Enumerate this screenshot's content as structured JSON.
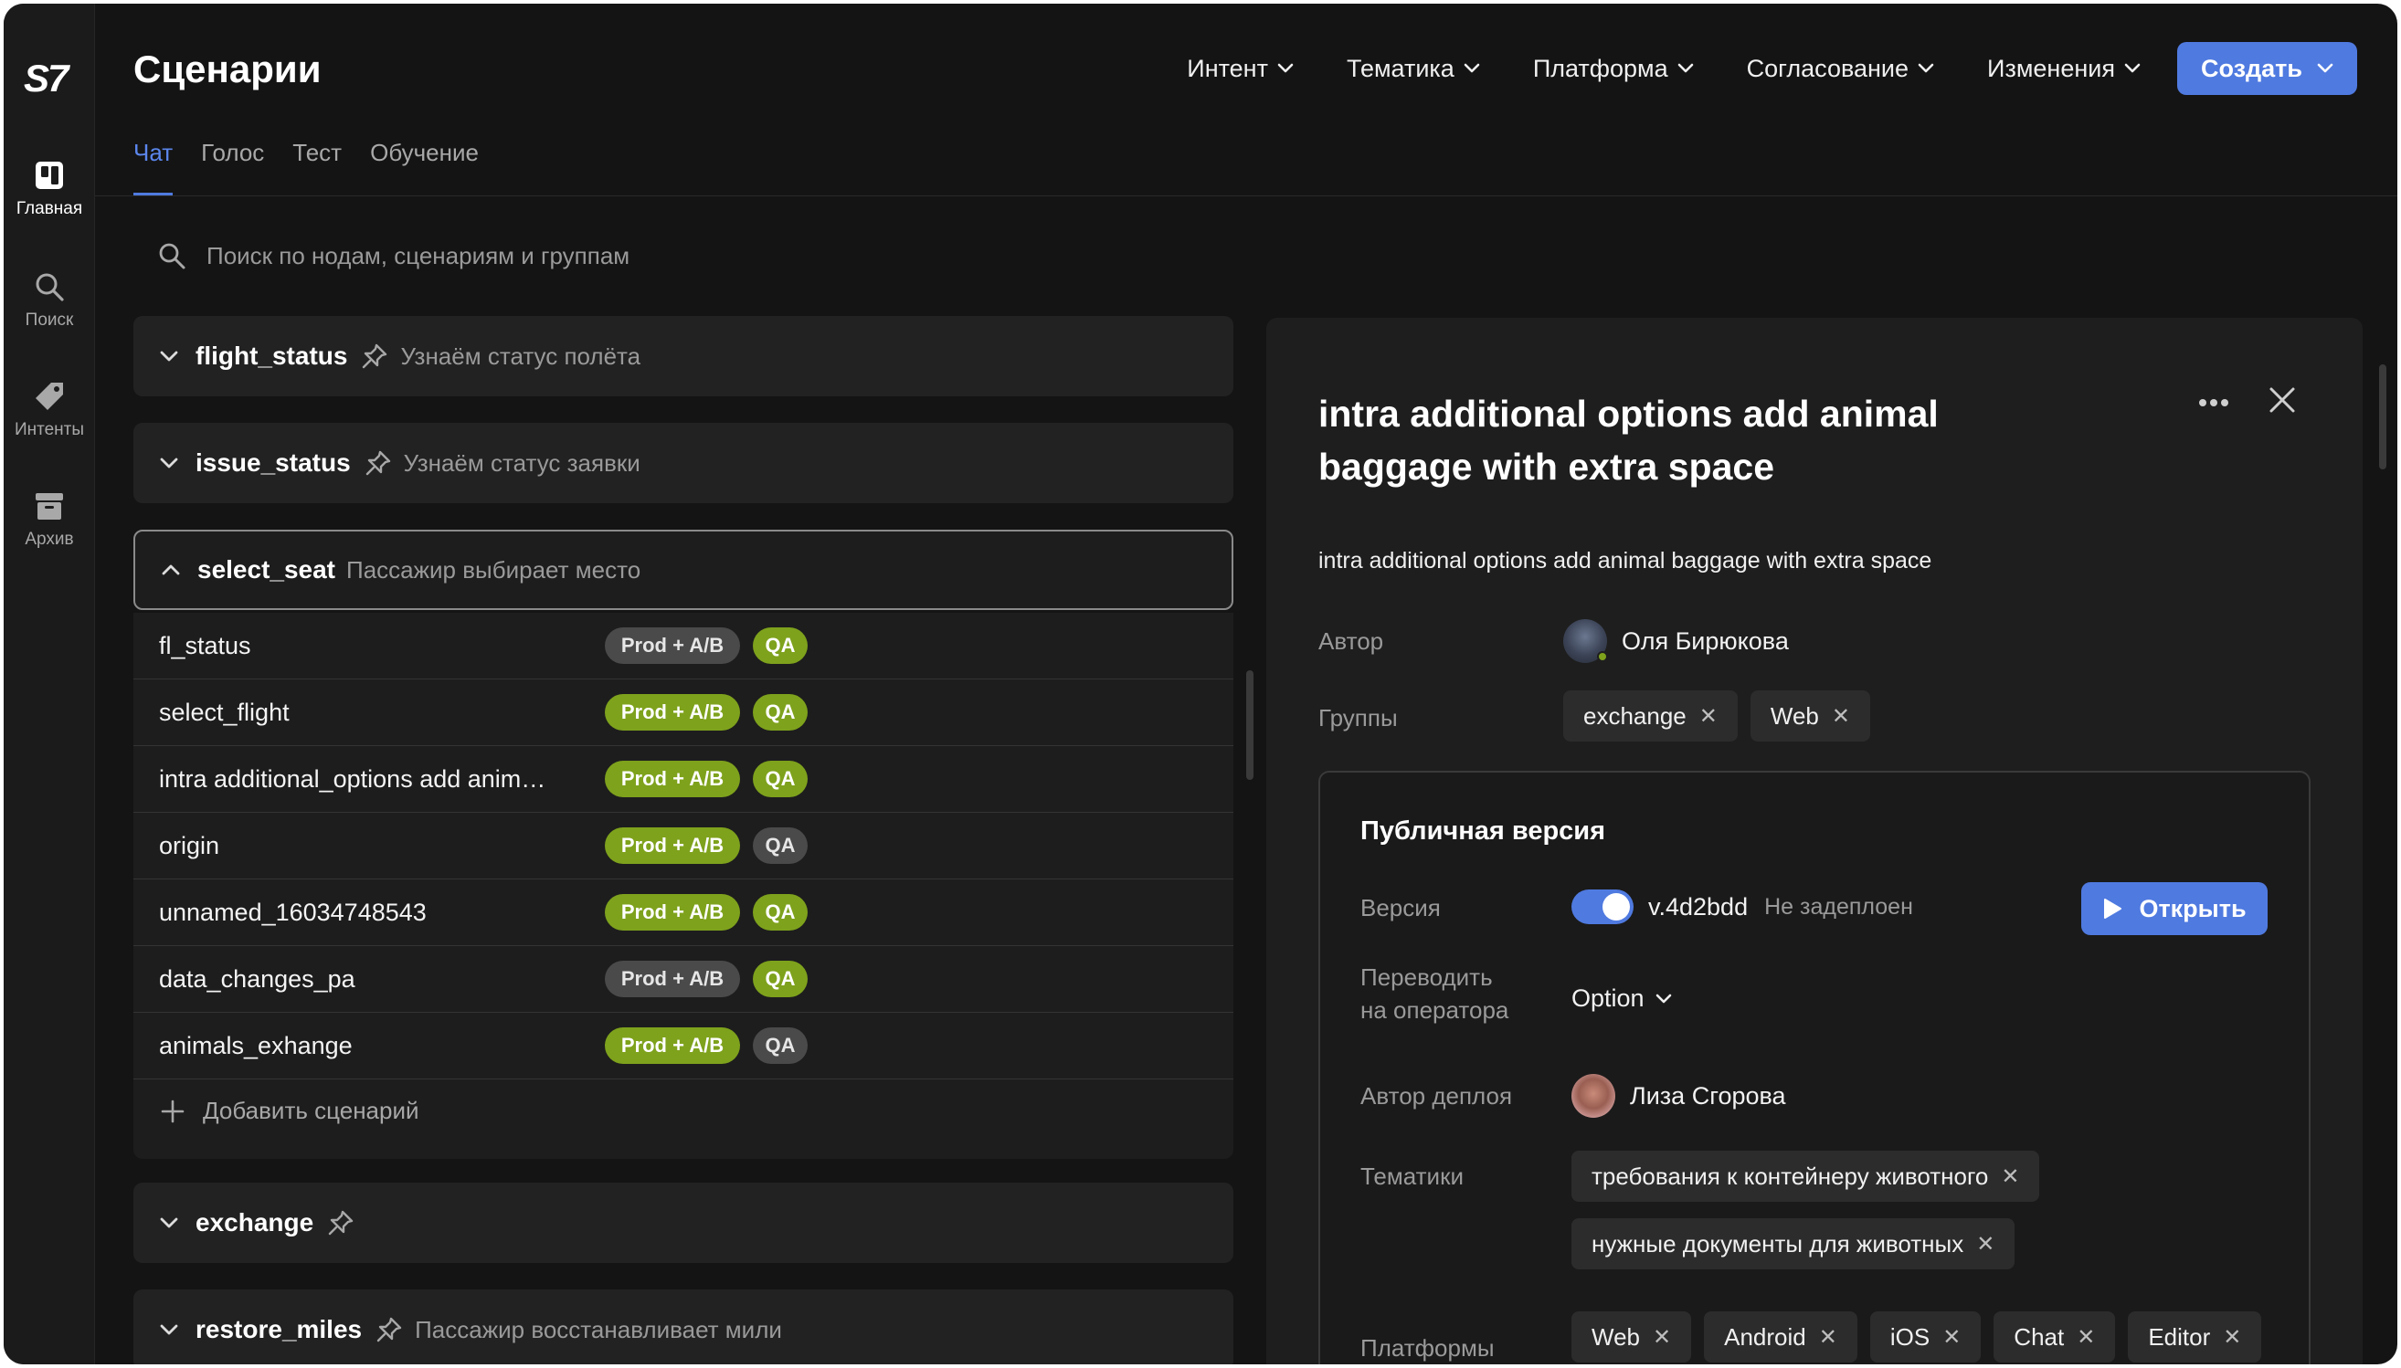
{
  "sidebar": {
    "logo": "S7",
    "items": [
      {
        "label": "Главная"
      },
      {
        "label": "Поиск"
      },
      {
        "label": "Интенты"
      },
      {
        "label": "Архив"
      }
    ]
  },
  "header": {
    "title": "Сценарии",
    "filters": [
      "Интент",
      "Тематика",
      "Платформа",
      "Согласование",
      "Изменения"
    ],
    "create_label": "Создать"
  },
  "tabs": [
    "Чат",
    "Голос",
    "Тест",
    "Обучение"
  ],
  "search": {
    "placeholder": "Поиск по нодам, сценариям и группам"
  },
  "groups": [
    {
      "name": "flight_status",
      "desc": "Узнаём статус полёта"
    },
    {
      "name": "issue_status",
      "desc": "Узнаём статус заявки"
    },
    {
      "name": "select_seat",
      "desc": "Пассажир выбирает место"
    },
    {
      "name": "exchange",
      "desc": ""
    },
    {
      "name": "restore_miles",
      "desc": "Пассажир восстанавливает мили"
    }
  ],
  "scenarios": [
    {
      "name": "fl_status",
      "prod": "Prod + A/B",
      "qa": "QA",
      "prod_state": "gray",
      "qa_state": "green"
    },
    {
      "name": "select_flight",
      "prod": "Prod + A/B",
      "qa": "QA",
      "prod_state": "green",
      "qa_state": "green"
    },
    {
      "name": "intra additional_options add animal_baggage",
      "prod": "Prod + A/B",
      "qa": "QA",
      "prod_state": "green",
      "qa_state": "green"
    },
    {
      "name": "origin",
      "prod": "Prod + A/B",
      "qa": "QA",
      "prod_state": "green",
      "qa_state": "gray"
    },
    {
      "name": "unnamed_16034748543",
      "prod": "Prod + A/B",
      "qa": "QA",
      "prod_state": "green",
      "qa_state": "green"
    },
    {
      "name": "data_changes_pa",
      "prod": "Prod + A/B",
      "qa": "QA",
      "prod_state": "gray",
      "qa_state": "green"
    },
    {
      "name": "animals_exhange",
      "prod": "Prod + A/B",
      "qa": "QA",
      "prod_state": "green",
      "qa_state": "gray"
    }
  ],
  "add_scenario_label": "Добавить сценарий",
  "panel": {
    "title": "intra additional options add animal baggage with extra space",
    "description": "intra additional options add animal baggage with extra space",
    "author_label": "Автор",
    "author": "Оля Бирюкова",
    "groups_label": "Группы",
    "groups": [
      "exchange",
      "Web"
    ],
    "public_version": {
      "title": "Публичная версия",
      "version_label": "Версия",
      "version": "v.4d2bdd",
      "deploy_status": "Не задеплоен",
      "open_label": "Открыть",
      "operator_label_line1": "Переводить",
      "operator_label_line2": "на оператора",
      "operator_value": "Option",
      "deploy_author_label": "Автор деплоя",
      "deploy_author": "Лиза Сгорова",
      "topics_label": "Тематики",
      "topics": [
        "требования к контейнеру животного",
        "нужные документы для животных"
      ],
      "platforms_label": "Платформы",
      "platforms": [
        "Web",
        "Android",
        "iOS",
        "Chat",
        "Editor"
      ]
    }
  },
  "colors": {
    "accent": "#4f7ae0",
    "status_green": "#7ea21c",
    "status_gray": "#4a4a4a",
    "background": "#141414"
  }
}
